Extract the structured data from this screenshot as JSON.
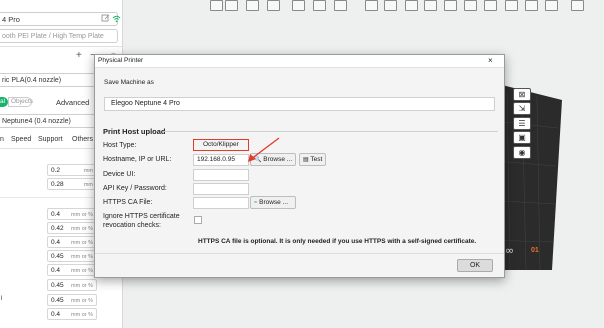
{
  "left_panel": {
    "printer_name": "4 Pro",
    "plate": "ooth PEI Plate / High Temp Plate",
    "add_label": "+",
    "remove_label": "−",
    "menu_label": "≡",
    "filament": "ric PLA(0.4 nozzle)",
    "tab_global": "al",
    "tab_objects": "Objects",
    "tab_advanced": "Advanced",
    "process": "Neptune4 (0.4 nozzle)",
    "columns": [
      "n",
      "Speed",
      "Support",
      "Others"
    ],
    "values": [
      {
        "v": "0.2",
        "u": "mm"
      },
      {
        "v": "0.28",
        "u": "mm"
      },
      {
        "v": "0.4",
        "u": "mm or %"
      },
      {
        "v": "0.42",
        "u": "mm or %"
      },
      {
        "v": "0.4",
        "u": "mm or %"
      },
      {
        "v": "0.45",
        "u": "mm or %"
      },
      {
        "v": "0.4",
        "u": "mm or %"
      },
      {
        "v": "0.45",
        "u": "mm or %"
      },
      {
        "v": "0.45",
        "u": "mm or %"
      },
      {
        "v": "0.4",
        "u": "mm or %"
      }
    ],
    "stray_char": "l"
  },
  "viewport": {
    "plate_label": "01",
    "loop_glyph": "∞"
  },
  "dialog": {
    "title": "Physical Printer",
    "close": "×",
    "save_machine_label": "Save Machine as",
    "machine_name": "Elegoo Neptune 4 Pro",
    "section_title": "Print Host upload",
    "host_type_label": "Host Type:",
    "host_type_value": "Octo/Klipper",
    "hostname_label": "Hostname, IP or URL:",
    "hostname_value": "192.168.0.95",
    "browse_label": "Browse ...",
    "test_label": "Test",
    "device_ui_label": "Device UI:",
    "api_key_label": "API Key / Password:",
    "https_ca_label": "HTTPS CA File:",
    "browse2_label": "Browse ...",
    "ignore_https_label_1": "Ignore HTTPS certificate",
    "ignore_https_label_2": "revocation checks:",
    "note": "HTTPS CA file is optional. It is only needed if you use HTTPS with a self-signed certificate.",
    "ok_label": "OK"
  },
  "colors": {
    "accent_green": "#18b26b",
    "annotation_red": "#e23b2a",
    "plate_orange": "#e8712f"
  }
}
